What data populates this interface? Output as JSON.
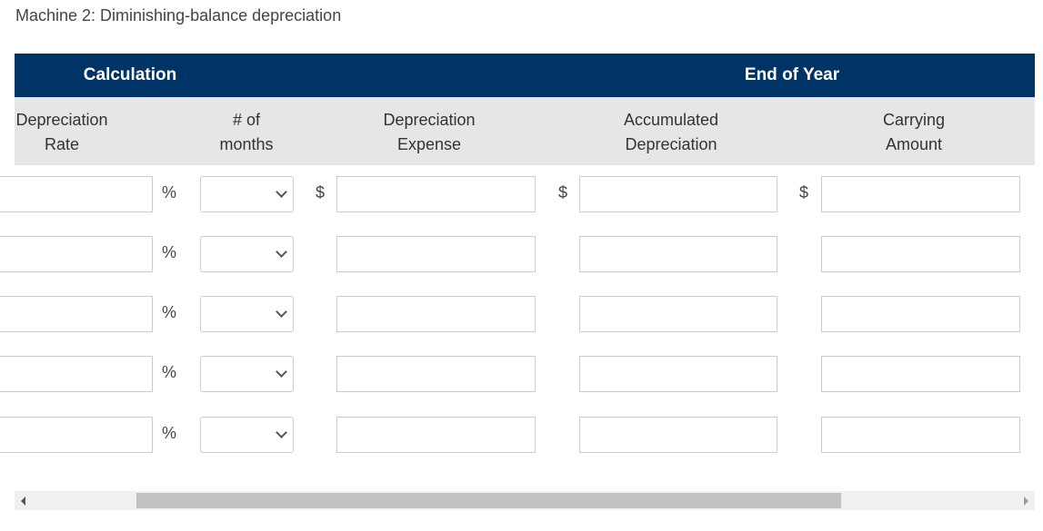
{
  "title": "Machine 2: Diminishing-balance depreciation",
  "group_headers": {
    "calculation": "Calculation",
    "end_of_year": "End of Year"
  },
  "columns": [
    {
      "line1": "Depreciation",
      "line2": "Rate"
    },
    {
      "line1": "# of",
      "line2": "months"
    },
    {
      "line1": "Depreciation",
      "line2": "Expense"
    },
    {
      "line1": "Accumulated",
      "line2": "Depreciation"
    },
    {
      "line1": "Carrying",
      "line2": "Amount"
    }
  ],
  "symbols": {
    "percent": "%",
    "dollar": "$"
  },
  "rows": [
    {
      "rate": "",
      "months": "",
      "expense": "",
      "accumulated": "",
      "carrying": "",
      "show_dollar": true
    },
    {
      "rate": "",
      "months": "",
      "expense": "",
      "accumulated": "",
      "carrying": "",
      "show_dollar": false
    },
    {
      "rate": "",
      "months": "",
      "expense": "",
      "accumulated": "",
      "carrying": "",
      "show_dollar": false
    },
    {
      "rate": "",
      "months": "",
      "expense": "",
      "accumulated": "",
      "carrying": "",
      "show_dollar": false
    },
    {
      "rate": "",
      "months": "",
      "expense": "",
      "accumulated": "",
      "carrying": "",
      "show_dollar": false
    }
  ]
}
